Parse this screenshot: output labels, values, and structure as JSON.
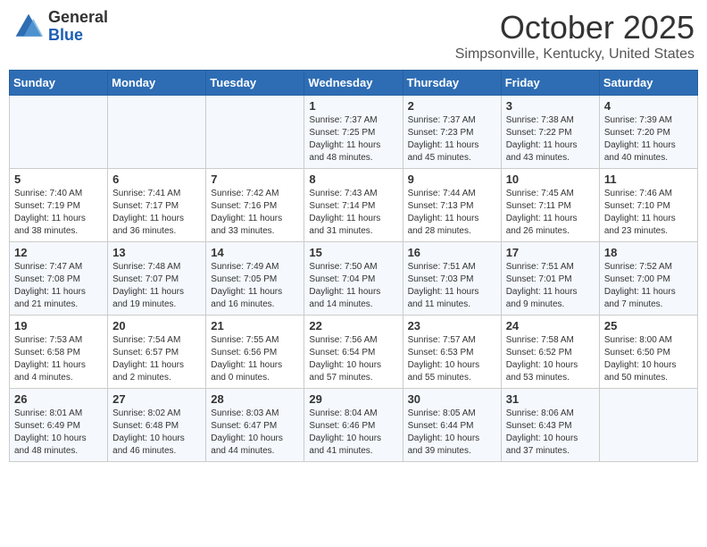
{
  "header": {
    "logo_general": "General",
    "logo_blue": "Blue",
    "month_title": "October 2025",
    "location": "Simpsonville, Kentucky, United States"
  },
  "days_of_week": [
    "Sunday",
    "Monday",
    "Tuesday",
    "Wednesday",
    "Thursday",
    "Friday",
    "Saturday"
  ],
  "weeks": [
    [
      {
        "day": "",
        "info": ""
      },
      {
        "day": "",
        "info": ""
      },
      {
        "day": "",
        "info": ""
      },
      {
        "day": "1",
        "info": "Sunrise: 7:37 AM\nSunset: 7:25 PM\nDaylight: 11 hours and 48 minutes."
      },
      {
        "day": "2",
        "info": "Sunrise: 7:37 AM\nSunset: 7:23 PM\nDaylight: 11 hours and 45 minutes."
      },
      {
        "day": "3",
        "info": "Sunrise: 7:38 AM\nSunset: 7:22 PM\nDaylight: 11 hours and 43 minutes."
      },
      {
        "day": "4",
        "info": "Sunrise: 7:39 AM\nSunset: 7:20 PM\nDaylight: 11 hours and 40 minutes."
      }
    ],
    [
      {
        "day": "5",
        "info": "Sunrise: 7:40 AM\nSunset: 7:19 PM\nDaylight: 11 hours and 38 minutes."
      },
      {
        "day": "6",
        "info": "Sunrise: 7:41 AM\nSunset: 7:17 PM\nDaylight: 11 hours and 36 minutes."
      },
      {
        "day": "7",
        "info": "Sunrise: 7:42 AM\nSunset: 7:16 PM\nDaylight: 11 hours and 33 minutes."
      },
      {
        "day": "8",
        "info": "Sunrise: 7:43 AM\nSunset: 7:14 PM\nDaylight: 11 hours and 31 minutes."
      },
      {
        "day": "9",
        "info": "Sunrise: 7:44 AM\nSunset: 7:13 PM\nDaylight: 11 hours and 28 minutes."
      },
      {
        "day": "10",
        "info": "Sunrise: 7:45 AM\nSunset: 7:11 PM\nDaylight: 11 hours and 26 minutes."
      },
      {
        "day": "11",
        "info": "Sunrise: 7:46 AM\nSunset: 7:10 PM\nDaylight: 11 hours and 23 minutes."
      }
    ],
    [
      {
        "day": "12",
        "info": "Sunrise: 7:47 AM\nSunset: 7:08 PM\nDaylight: 11 hours and 21 minutes."
      },
      {
        "day": "13",
        "info": "Sunrise: 7:48 AM\nSunset: 7:07 PM\nDaylight: 11 hours and 19 minutes."
      },
      {
        "day": "14",
        "info": "Sunrise: 7:49 AM\nSunset: 7:05 PM\nDaylight: 11 hours and 16 minutes."
      },
      {
        "day": "15",
        "info": "Sunrise: 7:50 AM\nSunset: 7:04 PM\nDaylight: 11 hours and 14 minutes."
      },
      {
        "day": "16",
        "info": "Sunrise: 7:51 AM\nSunset: 7:03 PM\nDaylight: 11 hours and 11 minutes."
      },
      {
        "day": "17",
        "info": "Sunrise: 7:51 AM\nSunset: 7:01 PM\nDaylight: 11 hours and 9 minutes."
      },
      {
        "day": "18",
        "info": "Sunrise: 7:52 AM\nSunset: 7:00 PM\nDaylight: 11 hours and 7 minutes."
      }
    ],
    [
      {
        "day": "19",
        "info": "Sunrise: 7:53 AM\nSunset: 6:58 PM\nDaylight: 11 hours and 4 minutes."
      },
      {
        "day": "20",
        "info": "Sunrise: 7:54 AM\nSunset: 6:57 PM\nDaylight: 11 hours and 2 minutes."
      },
      {
        "day": "21",
        "info": "Sunrise: 7:55 AM\nSunset: 6:56 PM\nDaylight: 11 hours and 0 minutes."
      },
      {
        "day": "22",
        "info": "Sunrise: 7:56 AM\nSunset: 6:54 PM\nDaylight: 10 hours and 57 minutes."
      },
      {
        "day": "23",
        "info": "Sunrise: 7:57 AM\nSunset: 6:53 PM\nDaylight: 10 hours and 55 minutes."
      },
      {
        "day": "24",
        "info": "Sunrise: 7:58 AM\nSunset: 6:52 PM\nDaylight: 10 hours and 53 minutes."
      },
      {
        "day": "25",
        "info": "Sunrise: 8:00 AM\nSunset: 6:50 PM\nDaylight: 10 hours and 50 minutes."
      }
    ],
    [
      {
        "day": "26",
        "info": "Sunrise: 8:01 AM\nSunset: 6:49 PM\nDaylight: 10 hours and 48 minutes."
      },
      {
        "day": "27",
        "info": "Sunrise: 8:02 AM\nSunset: 6:48 PM\nDaylight: 10 hours and 46 minutes."
      },
      {
        "day": "28",
        "info": "Sunrise: 8:03 AM\nSunset: 6:47 PM\nDaylight: 10 hours and 44 minutes."
      },
      {
        "day": "29",
        "info": "Sunrise: 8:04 AM\nSunset: 6:46 PM\nDaylight: 10 hours and 41 minutes."
      },
      {
        "day": "30",
        "info": "Sunrise: 8:05 AM\nSunset: 6:44 PM\nDaylight: 10 hours and 39 minutes."
      },
      {
        "day": "31",
        "info": "Sunrise: 8:06 AM\nSunset: 6:43 PM\nDaylight: 10 hours and 37 minutes."
      },
      {
        "day": "",
        "info": ""
      }
    ]
  ]
}
